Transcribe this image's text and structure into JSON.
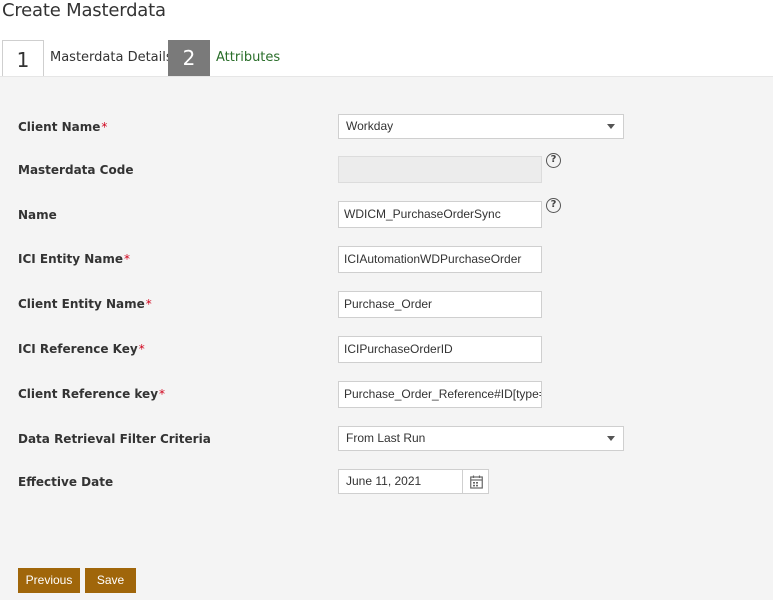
{
  "page": {
    "title": "Create Masterdata"
  },
  "wizard": {
    "steps": [
      {
        "number": "1",
        "label": "Masterdata Details"
      },
      {
        "number": "2",
        "label": "Attributes"
      }
    ]
  },
  "form": {
    "required_mark": "*",
    "help_glyph": "?",
    "fields": {
      "client_name": {
        "label": "Client Name",
        "value": "Workday"
      },
      "masterdata_code": {
        "label": "Masterdata Code",
        "value": ""
      },
      "name": {
        "label": "Name",
        "value": "WDICM_PurchaseOrderSync"
      },
      "ici_entity_name": {
        "label": "ICI Entity Name",
        "value": "ICIAutomationWDPurchaseOrder"
      },
      "client_entity_name": {
        "label": "Client Entity Name",
        "value": "Purchase_Order"
      },
      "ici_reference_key": {
        "label": "ICI Reference Key",
        "value": "ICIPurchaseOrderID"
      },
      "client_reference_key": {
        "label": "Client Reference key",
        "value": "Purchase_Order_Reference#ID[type="
      },
      "data_retrieval_filter": {
        "label": "Data Retrieval Filter Criteria",
        "value": "From Last Run"
      },
      "effective_date": {
        "label": "Effective Date",
        "value": "June 11, 2021"
      }
    }
  },
  "actions": {
    "previous_label": "Previous",
    "save_label": "Save"
  },
  "icons": {
    "help": "help-circle-icon",
    "calendar": "calendar-icon",
    "dropdown": "chevron-down-icon"
  },
  "colors": {
    "accent": "#a0660a",
    "step_active_bg": "#7a7a7a",
    "required": "#d0021b",
    "link_green": "#2a6e2a"
  }
}
